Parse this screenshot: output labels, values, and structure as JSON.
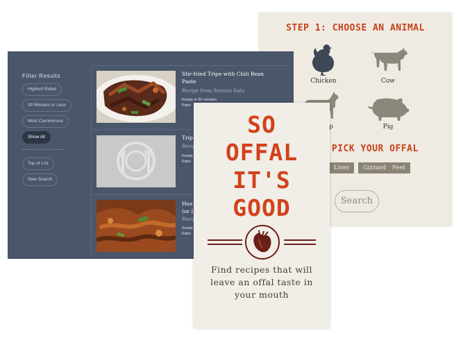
{
  "picker": {
    "step1_title": "STEP 1: CHOOSE AN ANIMAL",
    "step2_title": ": PICK YOUR OFFAL",
    "animals": [
      {
        "label": "Chicken",
        "icon": "chicken-icon"
      },
      {
        "label": "Cow",
        "icon": "cow-icon"
      },
      {
        "label": "p",
        "icon": "goat-icon"
      },
      {
        "label": "Pig",
        "icon": "pig-icon"
      }
    ],
    "offal_options": [
      "Liver",
      "Gizzard",
      "Feet"
    ],
    "search_label": "Search"
  },
  "results": {
    "filter_title": "Filter Results",
    "filters": [
      "Highest Rated",
      "30 Minutes or Less",
      "Most Carnivorous",
      "Show All"
    ],
    "actions": [
      "Top of List",
      "New Search"
    ],
    "items": [
      {
        "title": "Stir-fried Tripe with Chili Bean Paste",
        "source": "Recipe from Serious Eats",
        "meta1": "Ready in 60 minutes",
        "meta2": "Ratin"
      },
      {
        "title": "Trip",
        "source": "Recip",
        "meta1": "Ready",
        "meta2": "Ratin"
      },
      {
        "title": "Hus (or I",
        "source": "Recip",
        "meta1": "Ready",
        "meta2": "Ratin"
      }
    ]
  },
  "poster": {
    "headline": [
      "SO",
      "OFFAL",
      "IT'S",
      "GOOD"
    ],
    "tagline": "Find recipes that will leave an offal taste in your mouth"
  },
  "colors": {
    "accent": "#c7411b",
    "panel": "#4a5669",
    "paper": "#efebe2",
    "offal_button": "#8a8474"
  }
}
